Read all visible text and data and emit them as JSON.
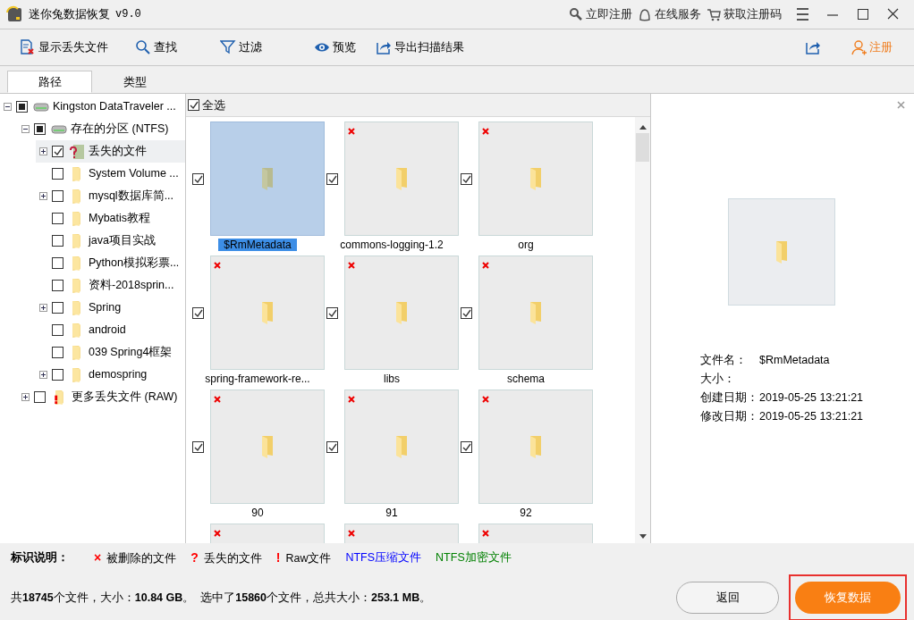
{
  "window": {
    "title": "迷你兔数据恢复",
    "version": "v9.0",
    "links": [
      "立即注册",
      "在线服务",
      "获取注册码"
    ]
  },
  "toolbar": {
    "buttons": [
      {
        "label": "显示丢失文件",
        "kind": "lostfile"
      },
      {
        "label": "查找",
        "kind": "search"
      },
      {
        "label": "过滤",
        "kind": "filter"
      },
      {
        "label": "预览",
        "kind": "eye"
      },
      {
        "label": "导出扫描结果",
        "kind": "export"
      }
    ],
    "register": "注册"
  },
  "tabs": [
    {
      "label": "路径",
      "selected": true
    },
    {
      "label": "类型",
      "selected": false
    }
  ],
  "tree": [
    {
      "label": "Kingston DataTraveler ...",
      "kind": "drive",
      "checked": false,
      "indeterminate": true,
      "expanded": true,
      "selected": false,
      "children": [
        {
          "label": "存在的分区 (NTFS)",
          "kind": "drive",
          "checked": false,
          "indeterminate": true,
          "expanded": true,
          "selected": false,
          "children": [
            {
              "label": "丢失的文件",
              "kind": "lost",
              "checked": true,
              "indeterminate": false,
              "expanded": false,
              "selected": true
            },
            {
              "label": "System Volume ...",
              "kind": "folder",
              "checked": false,
              "indeterminate": false,
              "selected": false
            },
            {
              "label": "mysql数据库简...",
              "kind": "folder",
              "checked": false,
              "indeterminate": false,
              "expanded": false,
              "selected": false
            },
            {
              "label": "Mybatis教程",
              "kind": "folder",
              "checked": false,
              "indeterminate": false,
              "selected": false
            },
            {
              "label": "java项目实战",
              "kind": "folder",
              "checked": false,
              "indeterminate": false,
              "selected": false
            },
            {
              "label": "Python模拟彩票...",
              "kind": "folder",
              "checked": false,
              "indeterminate": false,
              "selected": false
            },
            {
              "label": "资料-2018sprin...",
              "kind": "folder",
              "checked": false,
              "indeterminate": false,
              "selected": false
            },
            {
              "label": "Spring",
              "kind": "folder",
              "checked": false,
              "indeterminate": false,
              "expanded": false,
              "selected": false
            },
            {
              "label": "android",
              "kind": "folder",
              "checked": false,
              "indeterminate": false,
              "selected": false
            },
            {
              "label": "039  Spring4框架",
              "kind": "folder",
              "checked": false,
              "indeterminate": false,
              "selected": false
            },
            {
              "label": "demospring",
              "kind": "folder",
              "checked": false,
              "indeterminate": false,
              "expanded": false,
              "selected": false
            }
          ]
        },
        {
          "label": "更多丢失文件 (RAW)",
          "kind": "raw",
          "checked": false,
          "indeterminate": false,
          "expanded": false,
          "selected": false
        }
      ]
    }
  ],
  "grid": {
    "select_all": {
      "label": "全选",
      "checked": true
    },
    "items": [
      {
        "name": "$RmMetadata",
        "checked": true,
        "deleted": false,
        "selected": true
      },
      {
        "name": "commons-logging-1.2",
        "checked": true,
        "deleted": true,
        "selected": false
      },
      {
        "name": "org",
        "checked": true,
        "deleted": true,
        "selected": false
      },
      {
        "name": "spring-framework-re...",
        "checked": true,
        "deleted": true,
        "selected": false
      },
      {
        "name": "libs",
        "checked": true,
        "deleted": true,
        "selected": false
      },
      {
        "name": "schema",
        "checked": true,
        "deleted": true,
        "selected": false
      },
      {
        "name": "90",
        "checked": true,
        "deleted": true,
        "selected": false
      },
      {
        "name": "91",
        "checked": true,
        "deleted": true,
        "selected": false
      },
      {
        "name": "92",
        "checked": true,
        "deleted": true,
        "selected": false
      },
      {
        "deleted": true,
        "selected": false
      },
      {
        "deleted": true,
        "selected": false
      },
      {
        "deleted": true,
        "selected": false
      }
    ]
  },
  "preview": {
    "info": [
      {
        "label": "文件名：",
        "value": "$RmMetadata"
      },
      {
        "label": "大小："
      },
      {
        "label": "创建日期：",
        "value": "2019-05-25 13:21:21"
      },
      {
        "label": "修改日期：",
        "value": "2019-05-25 13:21:21"
      }
    ]
  },
  "legend": {
    "title": "标识说明：",
    "items": [
      {
        "mark": "×",
        "label": "被删除的文件",
        "color": "#ff0000"
      },
      {
        "mark": "?",
        "label": "丢失的文件",
        "color": "#ff0000"
      },
      {
        "mark": "!",
        "label": "Raw文件",
        "color": "#ff0000"
      },
      {
        "label": "NTFS压缩文件",
        "color": "#0000ff"
      },
      {
        "label": "NTFS加密文件",
        "color": "#008000"
      }
    ]
  },
  "status": "共**18745**个文件，大小：**10.84 GB**。  选中了**15860**个文件，总共大小：**253.1 MB**。",
  "buttons": [
    {
      "label": "返回",
      "kind": "secondary"
    },
    {
      "label": "恢复数据",
      "kind": "primary",
      "highlighted": true
    }
  ]
}
